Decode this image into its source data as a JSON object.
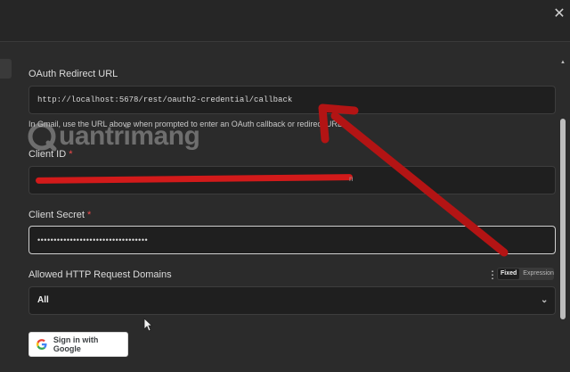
{
  "modal": {
    "close_icon": "close-icon"
  },
  "oauth_redirect": {
    "label": "OAuth Redirect URL",
    "value": "http://localhost:5678/rest/oauth2-credential/callback",
    "hint": "In Gmail, use the URL above when prompted to enter an OAuth callback or redirect URL"
  },
  "client_id": {
    "label": "Client ID",
    "required_mark": "*",
    "redacted_tail": "n"
  },
  "client_secret": {
    "label": "Client Secret",
    "required_mark": "*",
    "value": "••••••••••••••••••••••••••••••••••"
  },
  "allowed_domains": {
    "label": "Allowed HTTP Request Domains",
    "mode_fixed": "Fixed",
    "mode_expression": "Expression",
    "selected": "All"
  },
  "google_signin": {
    "label": "Sign in with Google"
  },
  "watermark": {
    "text": "uantrimang"
  },
  "colors": {
    "annotation_arrow": "#b31414",
    "redaction": "#d21a1a",
    "required": "#ef4a4a"
  }
}
